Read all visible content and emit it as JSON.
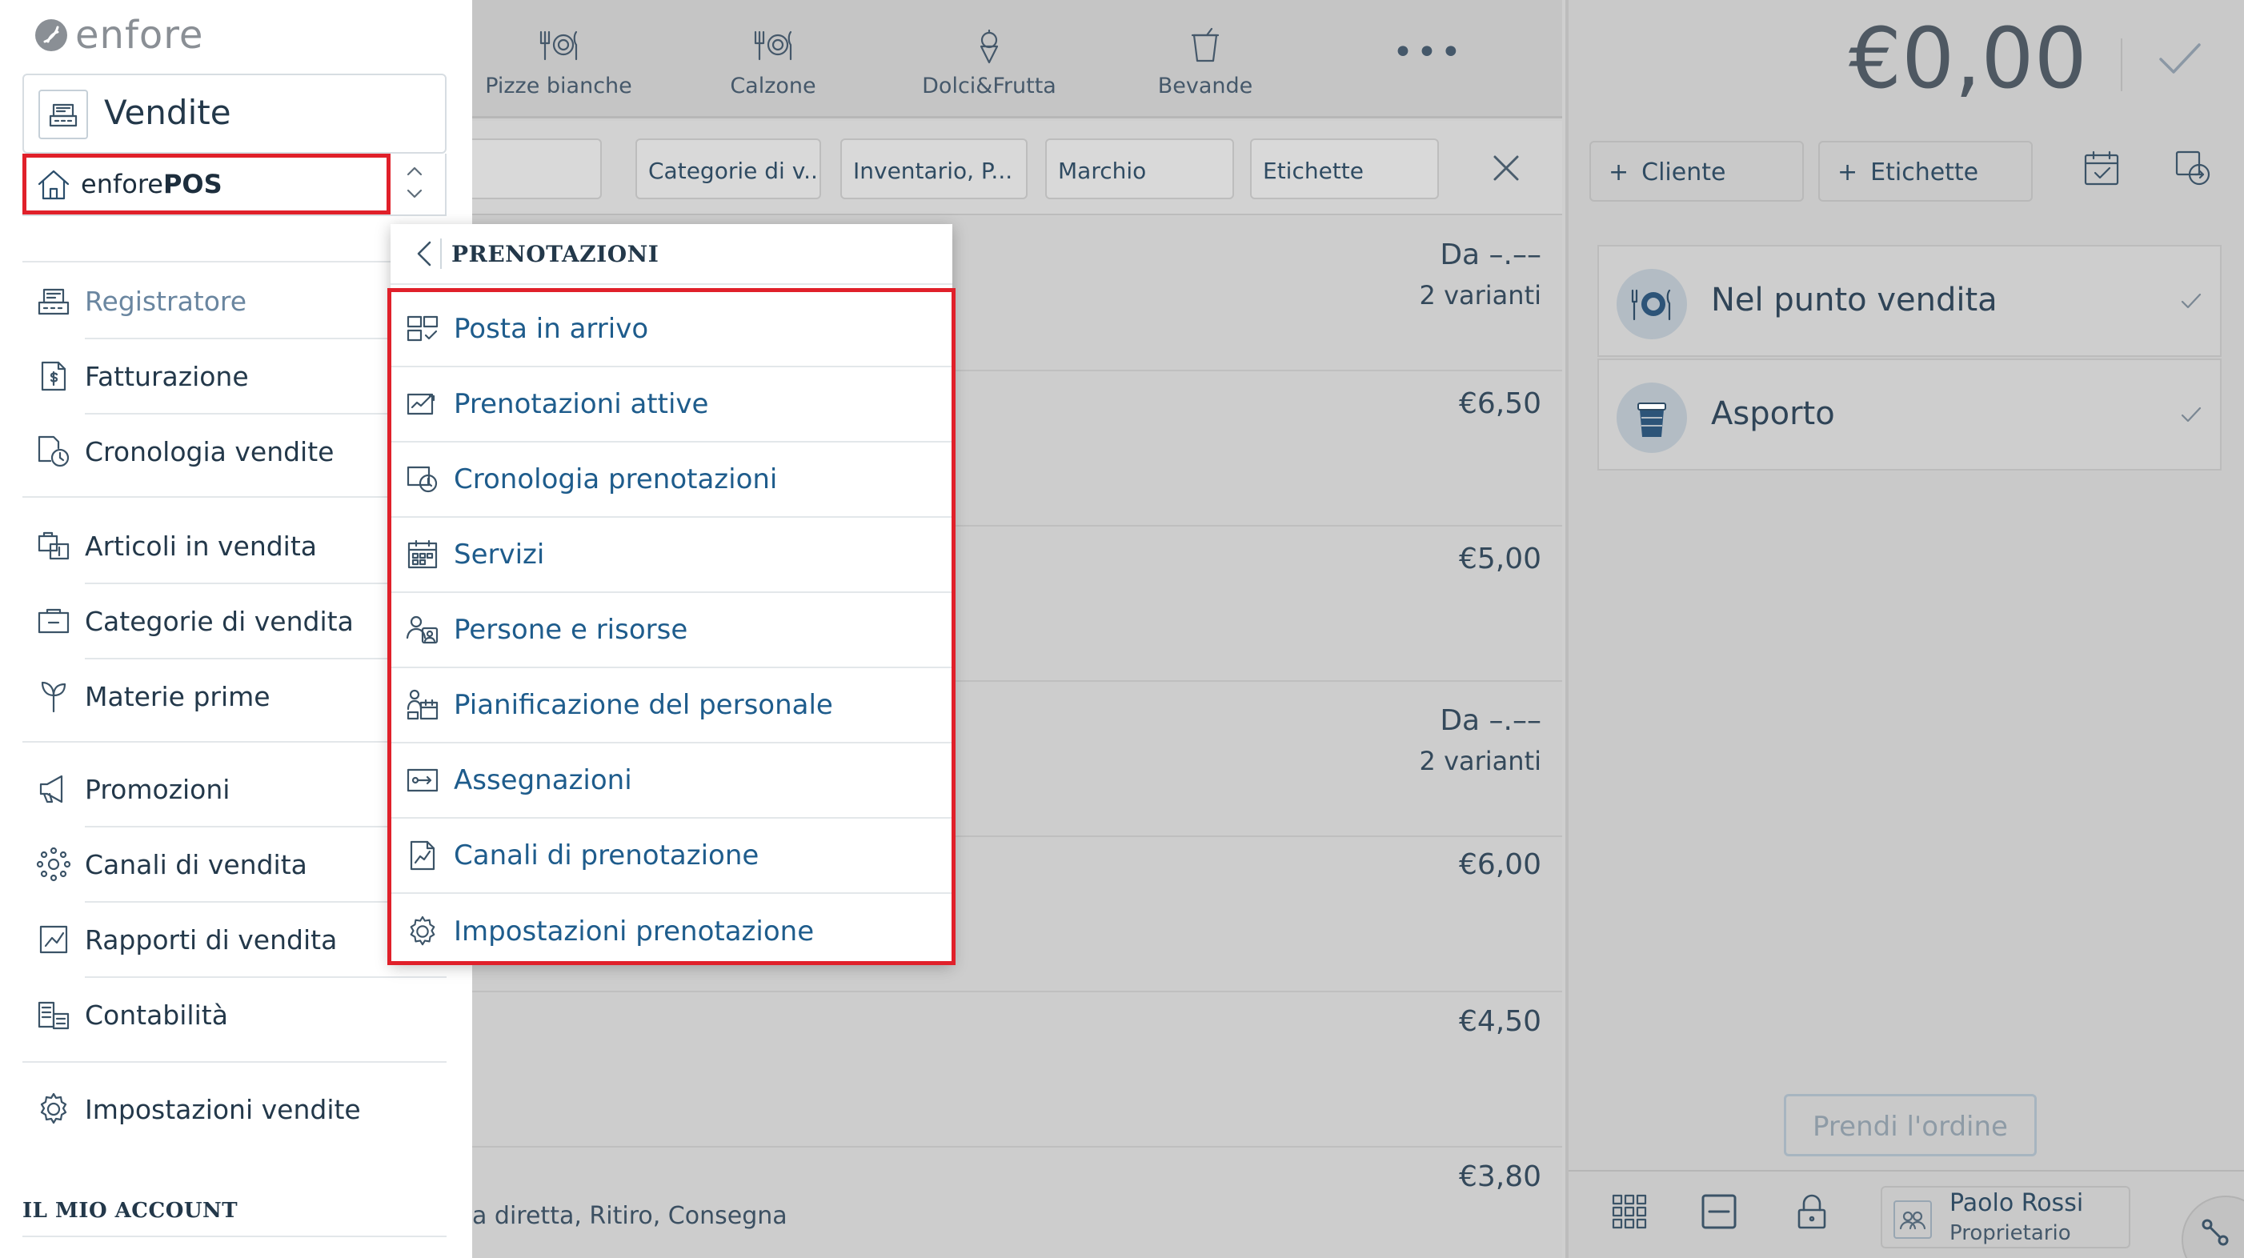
{
  "app": {
    "logo_text": "enfore"
  },
  "categories": [
    {
      "label": "Pizze bianche",
      "icon": "dish-icon"
    },
    {
      "label": "Calzone",
      "icon": "dish-icon"
    },
    {
      "label": "Dolci&Frutta",
      "icon": "ice-cream-icon"
    },
    {
      "label": "Bevande",
      "icon": "cup-icon"
    }
  ],
  "filters": {
    "chips": [
      "Categorie di v...",
      "Inventario, P...",
      "Marchio",
      "Etichette"
    ]
  },
  "products": [
    {
      "price": "Da –.––",
      "variants": "2 varianti"
    },
    {
      "price": "€6,50"
    },
    {
      "price": "€5,00"
    },
    {
      "price": "Da –.––",
      "variants": "2 varianti"
    },
    {
      "price": "€6,00"
    },
    {
      "price": "€4,50"
    },
    {
      "price": "€3,80",
      "desc": "a diretta, Ritiro, Consegna"
    }
  ],
  "order": {
    "total": "€0,00",
    "customer_label": "Cliente",
    "tags_label": "Etichette",
    "modes": [
      {
        "label": "Nel punto vendita",
        "icon": "dine-in-icon"
      },
      {
        "label": "Asporto",
        "icon": "takeaway-icon"
      }
    ],
    "take_order_label": "Prendi l'ordine",
    "user": {
      "name": "Paolo Rossi",
      "role": "Proprietario"
    }
  },
  "sidebar": {
    "section_title": "Vendite",
    "store": {
      "prefix": "enfore",
      "suffix": "POS"
    },
    "items": [
      {
        "label": "Registratore",
        "icon": "register-icon",
        "selected": true
      },
      {
        "label": "Fatturazione",
        "icon": "invoice-icon"
      },
      {
        "label": "Cronologia vendite",
        "icon": "sales-history-icon"
      },
      {
        "label": "Articoli in vendita",
        "icon": "articles-icon"
      },
      {
        "label": "Categorie di vendita",
        "icon": "categories-icon"
      },
      {
        "label": "Materie prime",
        "icon": "raw-materials-icon"
      },
      {
        "label": "Promozioni",
        "icon": "megaphone-icon"
      },
      {
        "label": "Canali di vendita",
        "icon": "channels-icon"
      },
      {
        "label": "Rapporti di vendita",
        "icon": "reports-icon"
      },
      {
        "label": "Contabilità",
        "icon": "accounting-icon"
      },
      {
        "label": "Impostazioni vendite",
        "icon": "gear-icon"
      }
    ],
    "account_header": "IL MIO ACCOUNT"
  },
  "reservations_menu": {
    "title": "PRENOTAZIONI",
    "items": [
      {
        "label": "Posta in arrivo",
        "icon": "inbox-icon"
      },
      {
        "label": "Prenotazioni attive",
        "icon": "active-bookings-icon"
      },
      {
        "label": "Cronologia prenotazioni",
        "icon": "booking-history-icon"
      },
      {
        "label": "Servizi",
        "icon": "services-icon"
      },
      {
        "label": "Persone e risorse",
        "icon": "people-icon"
      },
      {
        "label": "Pianificazione del personale",
        "icon": "staff-planning-icon"
      },
      {
        "label": "Assegnazioni",
        "icon": "assignments-icon"
      },
      {
        "label": "Canali di prenotazione",
        "icon": "booking-channels-icon"
      },
      {
        "label": "Impostazioni prenotazione",
        "icon": "gear-icon"
      }
    ]
  },
  "colors": {
    "highlight": "#e0202a",
    "link": "#1e5c8c",
    "text": "#23384a"
  }
}
